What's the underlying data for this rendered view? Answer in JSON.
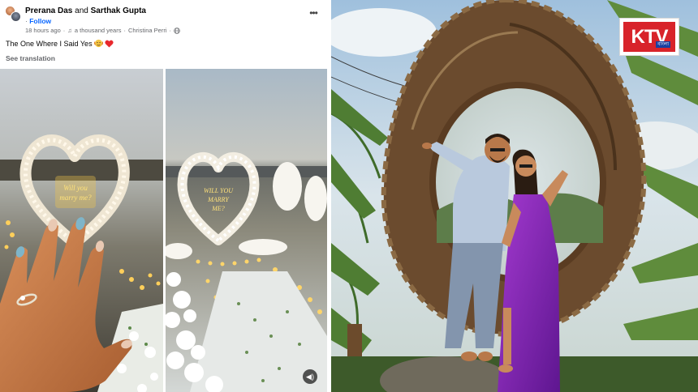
{
  "post": {
    "author_1": "Prerana Das",
    "conjunction": "and",
    "author_2": "Sarthak Gupta",
    "follow_label": "Follow",
    "time": "18 hours ago",
    "music": "a thousand years",
    "artist": "Christina Perri",
    "caption": "The One Where I Said Yes",
    "see_translation": "See translation"
  },
  "media": {
    "proposal_sign_1": "Will you marry me?",
    "proposal_sign_2": "WILL YOU MARRY ME?"
  },
  "logo": {
    "brand": "K",
    "brand_rest": "TV",
    "sub": "বাংলা"
  },
  "icons": [
    "avatar",
    "more-icon",
    "music-note-icon",
    "globe-icon",
    "kiss-emoji-icon",
    "heart-icon",
    "sound-icon"
  ],
  "colors": {
    "link": "#0866ff",
    "muted": "#65676b",
    "brand_red": "#d8232a",
    "brand_blue": "#1a3fa0"
  }
}
